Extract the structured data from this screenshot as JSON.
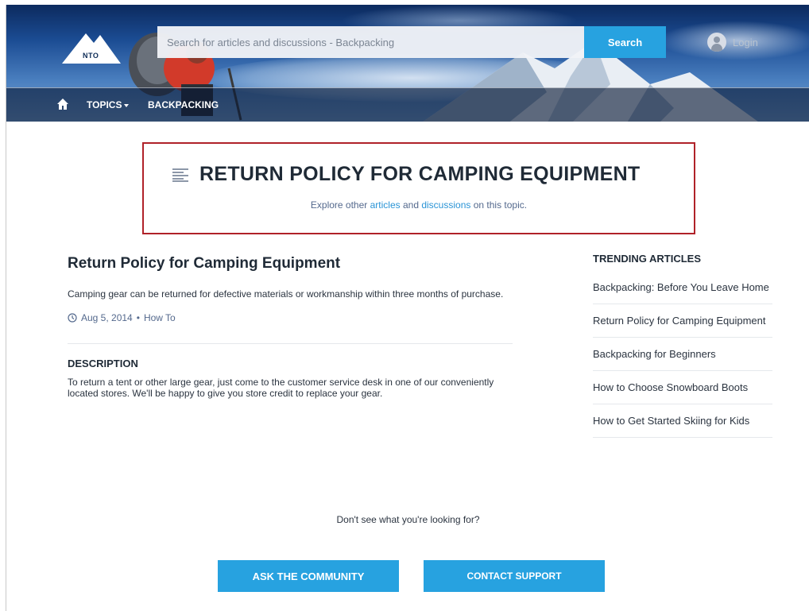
{
  "brand": {
    "logo_text": "NTO"
  },
  "search": {
    "placeholder": "Search for articles and discussions - Backpacking",
    "button_label": "Search"
  },
  "login": {
    "label": "Login"
  },
  "nav": {
    "topics_label": "TOPICS",
    "current_topic": "BACKPACKING"
  },
  "header": {
    "title": "RETURN POLICY FOR CAMPING EQUIPMENT",
    "explore_prefix": "Explore other",
    "articles_link": "articles",
    "explore_and": "and",
    "discussions_link": "discussions",
    "explore_suffix": "on this topic."
  },
  "article": {
    "title": "Return Policy for Camping Equipment",
    "summary": "Camping gear can be returned for defective materials or workmanship within three months of purchase.",
    "date": "Aug 5, 2014",
    "separator": "•",
    "type": "How To",
    "description_heading": "DESCRIPTION",
    "description": "To return a tent or other large gear, just come to the customer service desk in one of our conveniently located stores. We'll be happy to give you store credit to replace your gear."
  },
  "trending": {
    "heading": "TRENDING ARTICLES",
    "items": [
      "Backpacking: Before You Leave Home",
      "Return Policy for Camping Equipment",
      "Backpacking for Beginners",
      "How to Choose Snowboard Boots",
      "How to Get Started Skiing for Kids"
    ]
  },
  "footer": {
    "prompt": "Don't see what you're looking for?",
    "ask_label": "ASK THE COMMUNITY",
    "contact_label": "CONTACT SUPPORT"
  },
  "colors": {
    "accent": "#27a2e0",
    "highlight_border": "#b02229",
    "link": "#2a94d6"
  },
  "icons": [
    "home-icon",
    "caret-down-icon",
    "user-icon",
    "article-icon",
    "clock-icon",
    "logo-mountain-icon"
  ]
}
